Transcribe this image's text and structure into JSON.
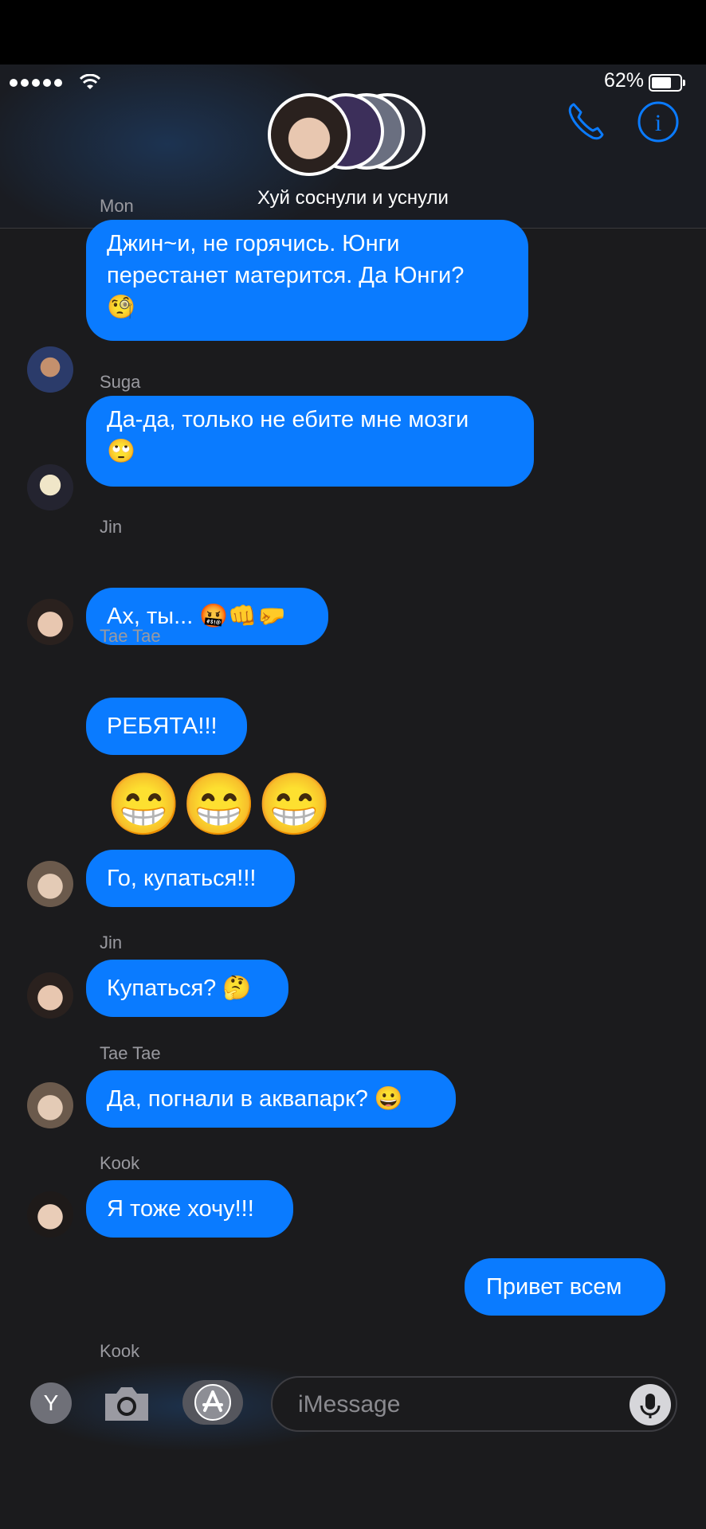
{
  "status_bar": {
    "battery_percent": "62%"
  },
  "header": {
    "group_title": "Хуй соснули и уснули",
    "call_icon": "phone-icon",
    "info_icon": "info-icon"
  },
  "messages": [
    {
      "sender": "Mon",
      "text": "Джин~и, не горячись. Юнги\nперестанет матерится. Да Юнги?\n🧐",
      "direction": "incoming"
    },
    {
      "sender": "Suga",
      "text": "Да-да, только не ебите мне мозги\n🙄",
      "direction": "incoming"
    },
    {
      "sender": "Jin",
      "text": "Ах, ты... 🤬👊🤛",
      "direction": "incoming"
    },
    {
      "sender": "Tae Tae",
      "text": "РЕБЯТА!!!",
      "direction": "incoming"
    },
    {
      "sender": "",
      "text": "😁😁😁",
      "direction": "incoming",
      "big_emoji": true
    },
    {
      "sender": "",
      "text": "Го, купаться!!!",
      "direction": "incoming"
    },
    {
      "sender": "Jin",
      "text": "Купаться? 🤔",
      "direction": "incoming"
    },
    {
      "sender": "Tae Tae",
      "text": "Да, погнали в аквапарк? 😀",
      "direction": "incoming"
    },
    {
      "sender": "Kook",
      "text": "Я тоже хочу!!!",
      "direction": "incoming"
    },
    {
      "sender": "",
      "text": "Привет всем",
      "direction": "outgoing"
    },
    {
      "sender": "Kook",
      "text": "",
      "direction": "incoming"
    }
  ],
  "input_bar": {
    "app_button_label": "Y",
    "placeholder": "iMessage",
    "camera_icon": "camera-icon",
    "appstore_icon": "app-store-icon",
    "mic_icon": "microphone-icon"
  },
  "colors": {
    "bubble_blue": "#0a7bff",
    "background": "#1b1b1d",
    "accent": "#0a7bff"
  }
}
